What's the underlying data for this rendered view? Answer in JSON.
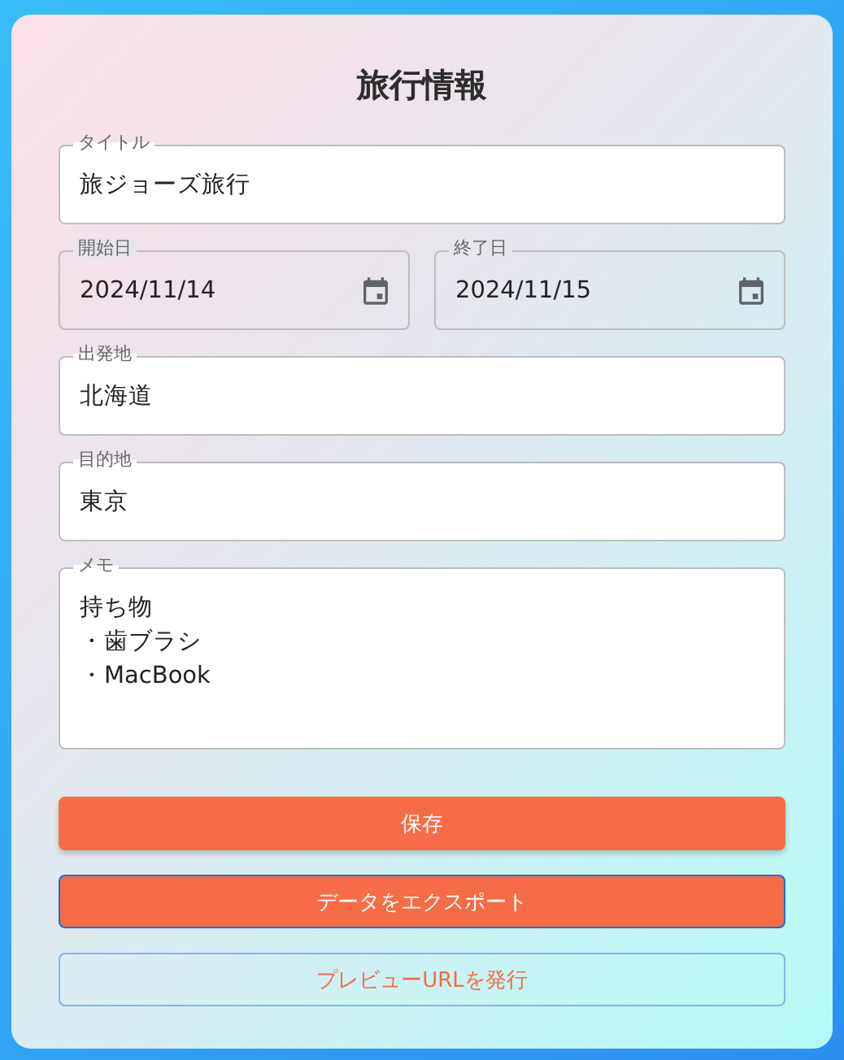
{
  "heading": "旅行情報",
  "fields": [
    {
      "kind": "text",
      "label": "タイトル",
      "value": "旅ジョーズ旅行"
    },
    {
      "kind": "date-pair",
      "items": [
        {
          "label": "開始日",
          "value": "2024/11/14"
        },
        {
          "label": "終了日",
          "value": "2024/11/15"
        }
      ]
    },
    {
      "kind": "text",
      "label": "出発地",
      "value": "北海道"
    },
    {
      "kind": "text",
      "label": "目的地",
      "value": "東京"
    },
    {
      "kind": "multiline",
      "label": "メモ",
      "lines": [
        "持ち物",
        "・歯ブラシ",
        "・MacBook"
      ]
    }
  ],
  "buttons": [
    {
      "label": "保存",
      "kind": "filled",
      "focused": false
    },
    {
      "label": "データをエクスポート",
      "kind": "filled",
      "focused": true
    },
    {
      "label": "プレビューURLを発行",
      "kind": "outlined",
      "focused": false
    }
  ]
}
